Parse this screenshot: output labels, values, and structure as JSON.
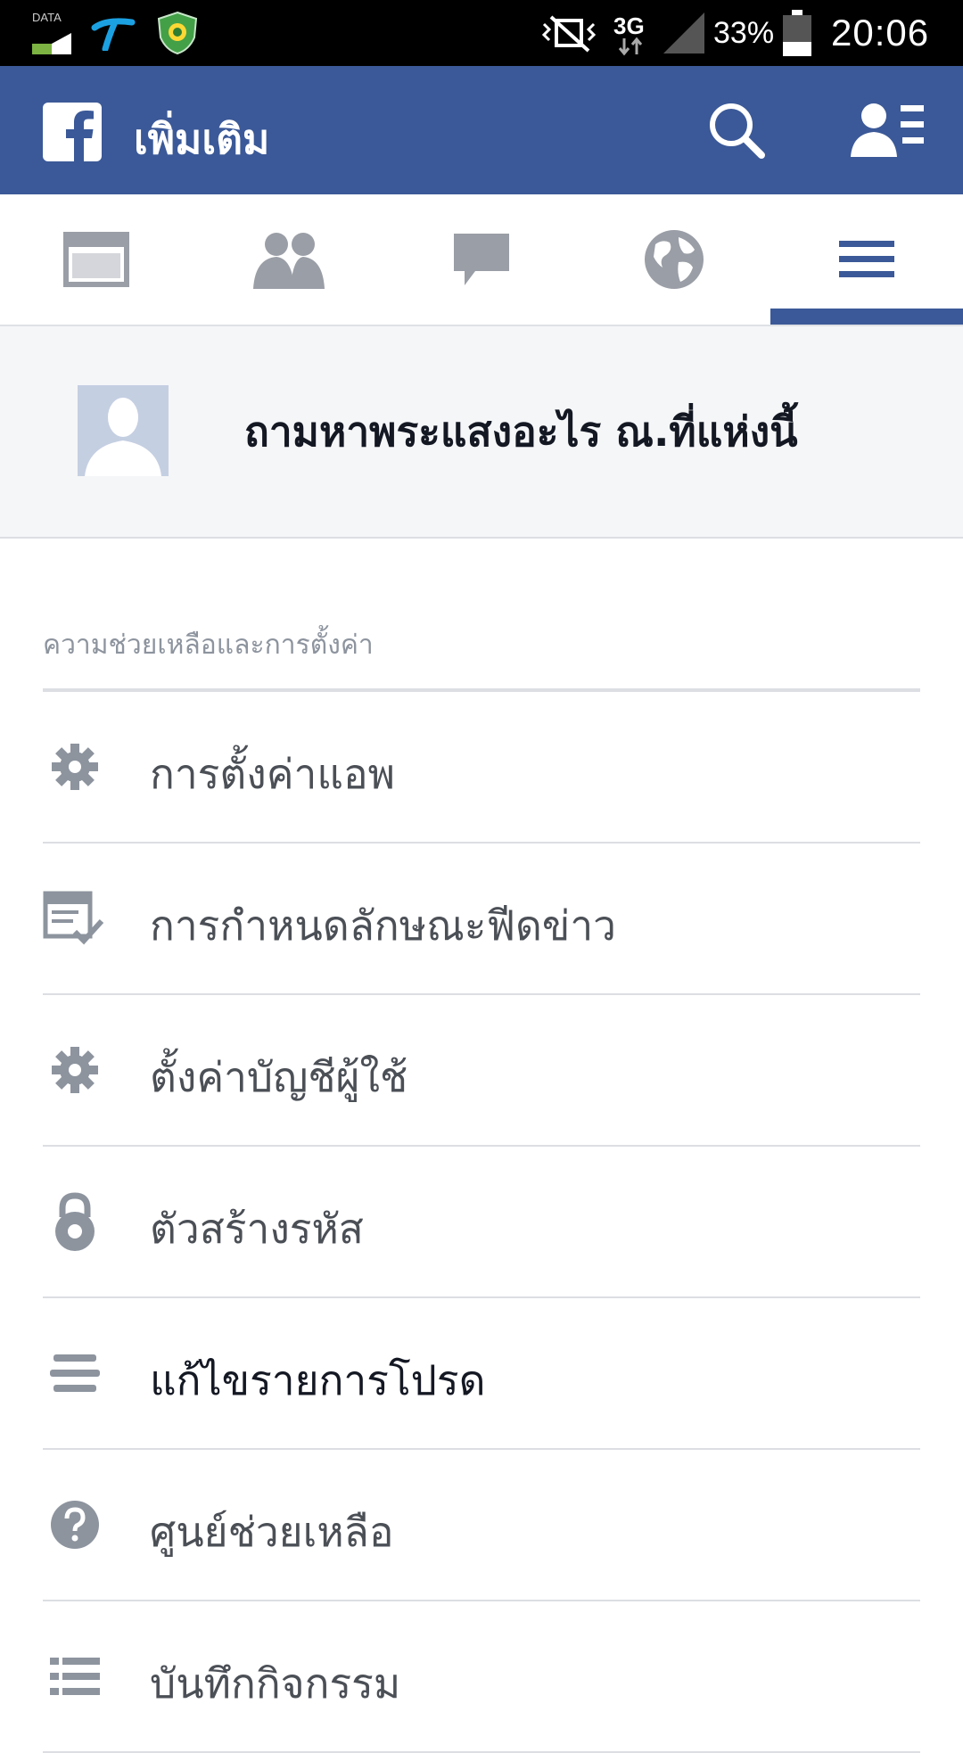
{
  "status_bar": {
    "data_label": "DATA",
    "network": "3G",
    "battery": "33%",
    "time": "20:06"
  },
  "header": {
    "title": "เพิ่มเติม"
  },
  "tabs": [
    {
      "icon": "news-feed-icon"
    },
    {
      "icon": "friends-icon"
    },
    {
      "icon": "messages-icon"
    },
    {
      "icon": "globe-icon"
    },
    {
      "icon": "menu-icon",
      "active": true
    }
  ],
  "profile": {
    "name": "ถามหาพระแสงอะไร ณ.ที่แห่งนี้"
  },
  "section": {
    "title": "ความช่วยเหลือและการตั้งค่า"
  },
  "menu": {
    "items": [
      {
        "label": "การตั้งค่าแอพ",
        "icon": "gear-icon"
      },
      {
        "label": "การกำหนดลักษณะฟีดข่าว",
        "icon": "news-feed-preferences-icon"
      },
      {
        "label": "ตั้งค่าบัญชีผู้ใช้",
        "icon": "gear-icon"
      },
      {
        "label": "ตัวสร้างรหัส",
        "icon": "lock-icon"
      },
      {
        "label": "แก้ไขรายการโปรด",
        "icon": "lines-icon"
      },
      {
        "label": "ศูนย์ช่วยเหลือ",
        "icon": "help-icon"
      },
      {
        "label": "บันทึกกิจกรรม",
        "icon": "list-icon"
      }
    ]
  },
  "colors": {
    "brand": "#3b5998",
    "status_bar": "#000000",
    "profile_bg": "#f5f6f8",
    "text_muted": "#8d949e"
  }
}
